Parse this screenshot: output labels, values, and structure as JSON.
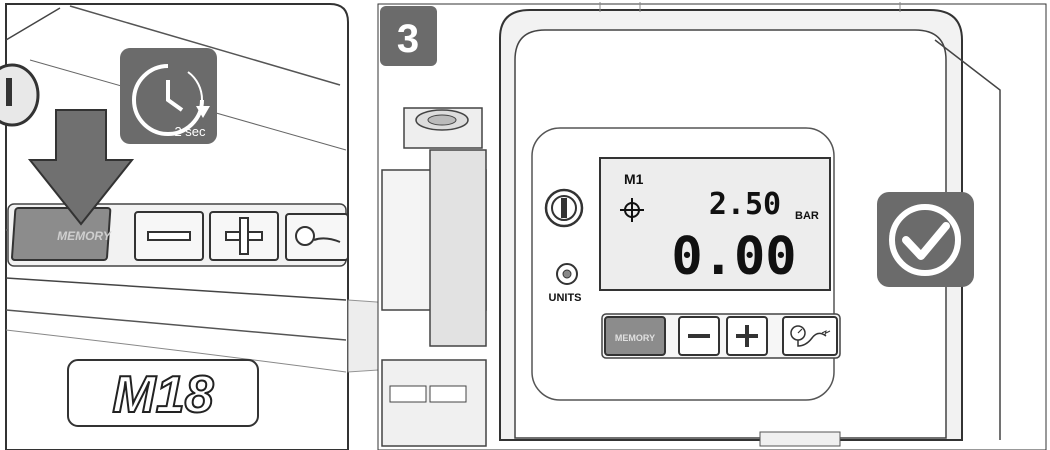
{
  "step": {
    "number": "3"
  },
  "timer": {
    "label": "2 sec"
  },
  "closeup": {
    "memory_label": "MEMORY",
    "brand": "M18"
  },
  "display": {
    "memory_slot": "M1",
    "target_value": "2.50",
    "unit": "BAR",
    "current_value": "0.00"
  },
  "units_label": "UNITS",
  "buttons": {
    "memory": "MEMORY",
    "minus": "−",
    "plus": "+"
  },
  "colors": {
    "badge": "#6b6b6b",
    "memory_button": "#8c8c8c",
    "arrow": "#707070",
    "outline": "#333333"
  },
  "icons": {
    "timer": "clock-icon",
    "press": "down-arrow-icon",
    "power": "power-icon",
    "target": "crosshair-icon",
    "gauge": "gauge-hose-icon",
    "confirm": "checkmark-icon"
  }
}
